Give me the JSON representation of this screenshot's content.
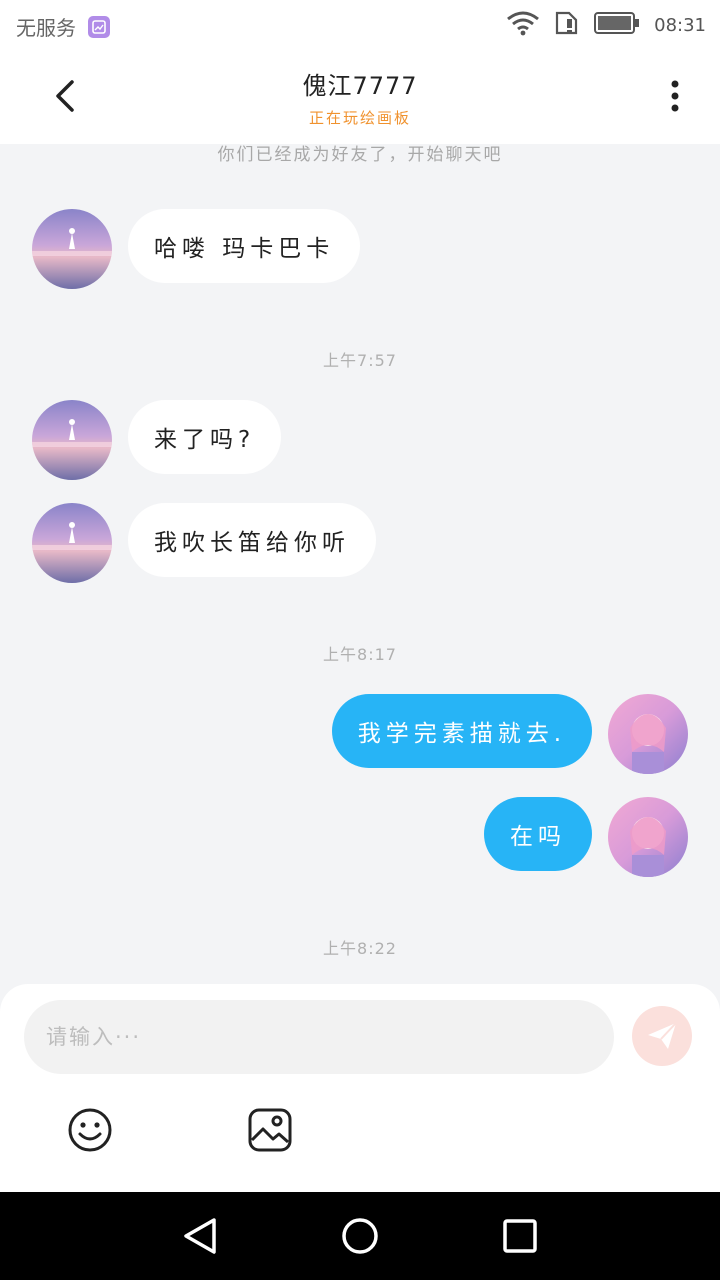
{
  "status_bar": {
    "carrier": "无服务",
    "time": "08:31",
    "icons": [
      "gallery-app-icon",
      "wifi-icon",
      "sim-icon",
      "battery-icon"
    ]
  },
  "header": {
    "title": "傀江7777",
    "subtitle": "正在玩绘画板",
    "icons": [
      "back-arrow-icon",
      "more-vertical-icon"
    ]
  },
  "chat": {
    "system_notice": "你们已经成为好友了，开始聊天吧",
    "timestamps": [
      "上午7:57",
      "上午8:17",
      "上午8:22"
    ],
    "messages": [
      {
        "side": "in",
        "text": "哈喽 玛卡巴卡"
      },
      {
        "side": "in",
        "text": "来了吗?"
      },
      {
        "side": "in",
        "text": "我吹长笛给你听"
      },
      {
        "side": "out",
        "text": "我学完素描就去."
      },
      {
        "side": "out",
        "text": "在吗"
      }
    ]
  },
  "composer": {
    "placeholder": "请输入···",
    "icons": [
      "send-icon",
      "emoji-icon",
      "image-icon"
    ]
  },
  "colors": {
    "accent_blue": "#27b4f6",
    "subtitle_orange": "#f0922e",
    "send_button_bg": "#fbe0dc",
    "chat_bg": "#f3f4f6"
  },
  "nav_bar": {
    "icons": [
      "back-triangle-icon",
      "home-circle-icon",
      "recents-square-icon"
    ]
  }
}
